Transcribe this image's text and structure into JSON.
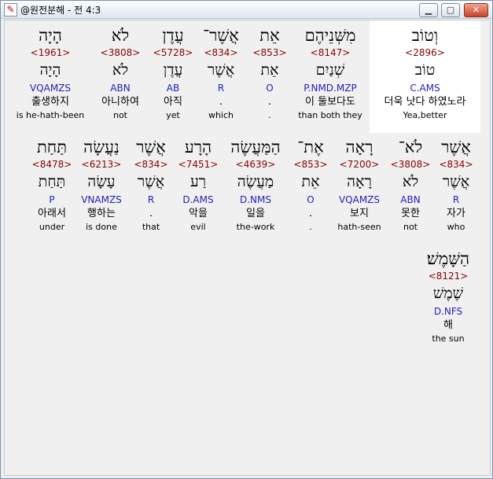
{
  "window": {
    "title": "@원전분해 - 전 4:3",
    "icon": "bible-app-icon",
    "controls": {
      "minimize": "▁",
      "maximize": "▢",
      "close": "✕"
    }
  },
  "rows": [
    [
      {
        "heb": "הָיָה",
        "strong": "<1961>",
        "lex": "הָיָה",
        "morph": "VQAMZS",
        "kor": "출생하지",
        "eng": "is he-hath-been"
      },
      {
        "heb": "לֹא",
        "strong": "<3808>",
        "lex": "לֹא",
        "morph": "ABN",
        "kor": "아니하여",
        "eng": "not"
      },
      {
        "heb": "עֲדֶן",
        "strong": "<5728>",
        "lex": "עֲדֶן",
        "morph": "AB",
        "kor": "아직",
        "eng": "yet"
      },
      {
        "heb": "אֲשֶׁר־",
        "strong": "<834>",
        "lex": "אֲשֶׁר",
        "morph": "R",
        "kor": ".",
        "eng": "which"
      },
      {
        "heb": "אֵת",
        "strong": "<853>",
        "lex": "אֵת",
        "morph": "O",
        "kor": ".",
        "eng": "."
      },
      {
        "heb": "מִשְּׁנֵיהֶם",
        "strong": "<8147>",
        "lex": "שְׁנַיִם",
        "morph": "P.NMD.MZP",
        "kor": "이 둘보다도",
        "eng": "than both they"
      },
      {
        "heb": "וְטוֹב",
        "strong": "<2896>",
        "lex": "טוֹב",
        "morph": "C.AMS",
        "kor": "더욱 낫다 하였노라",
        "eng": "Yea,better"
      }
    ],
    [
      {
        "heb": "תַּחַת",
        "strong": "<8478>",
        "lex": "תַּחַת",
        "morph": "P",
        "kor": "아래서",
        "eng": "under"
      },
      {
        "heb": "נַעֲשָׂה",
        "strong": "<6213>",
        "lex": "עָשָׂה",
        "morph": "VNAMZS",
        "kor": "행하는",
        "eng": "is done"
      },
      {
        "heb": "אֲשֶׁר",
        "strong": "<834>",
        "lex": "אֲשֶׁר",
        "morph": "R",
        "kor": ".",
        "eng": "that"
      },
      {
        "heb": "הָרָע",
        "strong": "<7451>",
        "lex": "רַע",
        "morph": "D.AMS",
        "kor": "악을",
        "eng": "evil"
      },
      {
        "heb": "הַמַּעֲשֶׂה",
        "strong": "<4639>",
        "lex": "מַעֲשֶׂה",
        "morph": "D.NMS",
        "kor": "일을",
        "eng": "the-work"
      },
      {
        "heb": "אֶת־",
        "strong": "<853>",
        "lex": "אֵת",
        "morph": "O",
        "kor": ".",
        "eng": "."
      },
      {
        "heb": "רָאָה",
        "strong": "<7200>",
        "lex": "רָאָה",
        "morph": "VQAMZS",
        "kor": "보지",
        "eng": "hath-seen"
      },
      {
        "heb": "לֹא־",
        "strong": "<3808>",
        "lex": "לֹא",
        "morph": "ABN",
        "kor": "못한",
        "eng": "not"
      },
      {
        "heb": "אֲשֶׁר",
        "strong": "<834>",
        "lex": "אֲשֶׁר",
        "morph": "R",
        "kor": "자가",
        "eng": "who"
      }
    ],
    [
      {
        "heb": "הַשָּׁמֶשׁ׃",
        "strong": "<8121>",
        "lex": "שֶׁמֶשׁ",
        "morph": "D.NFS",
        "kor": "해",
        "eng": "the sun"
      }
    ]
  ]
}
